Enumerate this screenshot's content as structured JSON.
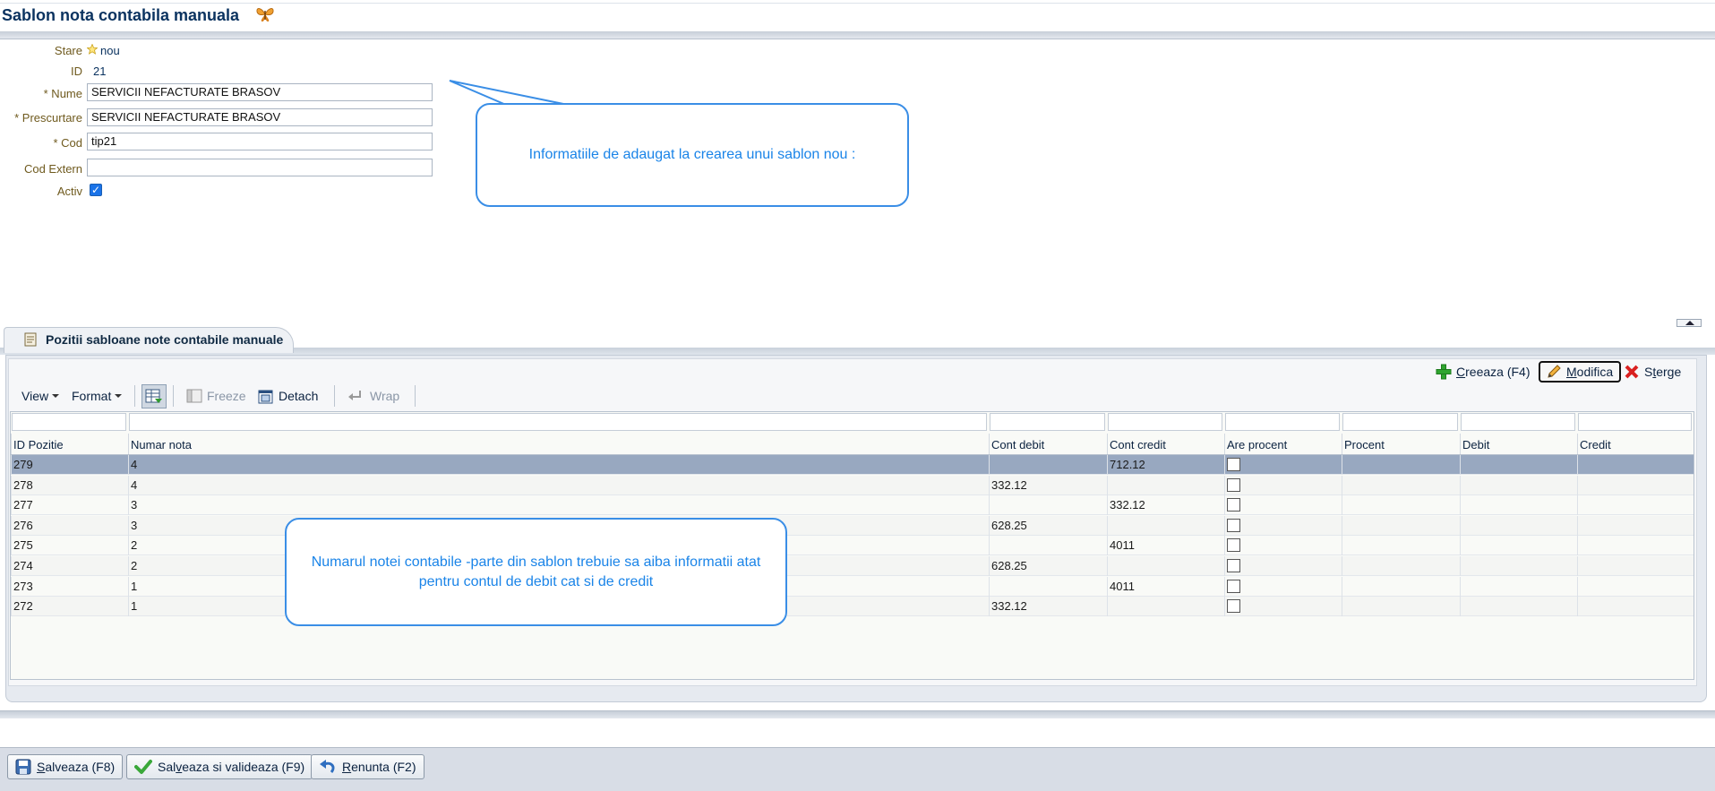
{
  "page": {
    "title": "Sablon nota contabila manuala"
  },
  "form": {
    "stare_label": "Stare",
    "stare_value": "nou",
    "id_label": "ID",
    "id_value": "21",
    "nume_label": "* Nume",
    "nume_value": "SERVICII NEFACTURATE BRASOV",
    "prescurtare_label": "* Prescurtare",
    "prescurtare_value": "SERVICII NEFACTURATE BRASOV",
    "cod_label": "* Cod",
    "cod_value": "tip21",
    "cod_extern_label": "Cod Extern",
    "cod_extern_value": "",
    "activ_label": "Activ",
    "activ_checked": true
  },
  "callouts": {
    "top": "Informatiile de adaugat la crearea unui sablon nou :",
    "bottom": "Numarul notei contabile -parte din sablon trebuie sa aiba informatii atat pentru contul de debit cat si de credit"
  },
  "panel": {
    "tab_label": "Pozitii sabloane note contabile manuale",
    "actions": {
      "create": "Creeaza (F4)",
      "modify": "Modifica",
      "delete": "Sterge"
    },
    "toolbar": {
      "view": "View",
      "format": "Format",
      "freeze": "Freeze",
      "detach": "Detach",
      "wrap": "Wrap"
    }
  },
  "table": {
    "columns": [
      "ID Pozitie",
      "Numar nota",
      "Cont debit",
      "Cont credit",
      "Are procent",
      "Procent",
      "Debit",
      "Credit"
    ],
    "rows": [
      {
        "id": "279",
        "nota": "4",
        "debit_cont": "",
        "credit_cont": "712.12",
        "are_procent": false,
        "selected": true
      },
      {
        "id": "278",
        "nota": "4",
        "debit_cont": "332.12",
        "credit_cont": "",
        "are_procent": false
      },
      {
        "id": "277",
        "nota": "3",
        "debit_cont": "",
        "credit_cont": "332.12",
        "are_procent": false
      },
      {
        "id": "276",
        "nota": "3",
        "debit_cont": "628.25",
        "credit_cont": "",
        "are_procent": false
      },
      {
        "id": "275",
        "nota": "2",
        "debit_cont": "",
        "credit_cont": "4011",
        "are_procent": false
      },
      {
        "id": "274",
        "nota": "2",
        "debit_cont": "628.25",
        "credit_cont": "",
        "are_procent": false
      },
      {
        "id": "273",
        "nota": "1",
        "debit_cont": "",
        "credit_cont": "4011",
        "are_procent": false
      },
      {
        "id": "272",
        "nota": "1",
        "debit_cont": "332.12",
        "credit_cont": "",
        "are_procent": false
      }
    ]
  },
  "footer": {
    "save": "Salveaza (F8)",
    "save_validate": "Salveaza si valideaza (F9)",
    "cancel": "Renunta (F2)"
  }
}
